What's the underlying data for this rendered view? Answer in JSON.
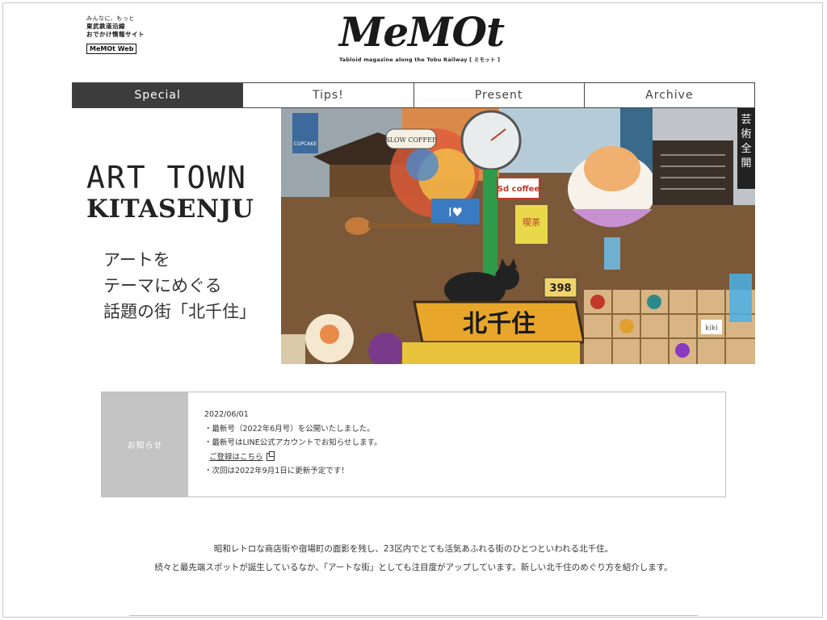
{
  "brand": {
    "tagline_line1": "みんなに、もっと",
    "tagline_line2": "東武鉄道沿線",
    "tagline_line3": "おでかけ情報サイト",
    "web_label": "MeMOt Web"
  },
  "logo": {
    "text": "MeMOt",
    "tagline": "Tabloid magazine along the Tobu Railway [ ミモット ]"
  },
  "nav": {
    "tabs": [
      {
        "label": "Special",
        "active": true
      },
      {
        "label": "Tips!",
        "active": false
      },
      {
        "label": "Present",
        "active": false
      },
      {
        "label": "Archive",
        "active": false
      }
    ]
  },
  "hero": {
    "title_line1": "ART TOWN",
    "title_line2": "KITASENJU",
    "copy_line1": "アートを",
    "copy_line2": "テーマにめぐる",
    "copy_line3": "話題の街「北千住」",
    "collage_signs": {
      "vertical_sign": "芸術全開",
      "coffee_sign": "Sd coffee",
      "slow_coffee": "SLOW COFFEE",
      "love_sign": "I♥",
      "cupcake": "CUPCAKE",
      "kissa": "喫茶",
      "banner": "北千住",
      "number": "398",
      "kiki": "kiki"
    }
  },
  "notice": {
    "label": "お知らせ",
    "date": "2022/06/01",
    "line1": "・最新号（2022年6月号）を公開いたしました。",
    "line2": "・最新号はLINE公式アカウントでお知らせします。",
    "link_label": "ご登録はこちら",
    "line3": "・次回は2022年9月1日に更新予定です！"
  },
  "intro": {
    "line1": "昭和レトロな商店街や宿場町の面影を残し、23区内でとても活気あふれる街のひとつといわれる北千住。",
    "line2": "続々と最先端スポットが誕生しているなか、「アートな街」としても注目度がアップしています。新しい北千住のめぐり方を紹介します。"
  }
}
